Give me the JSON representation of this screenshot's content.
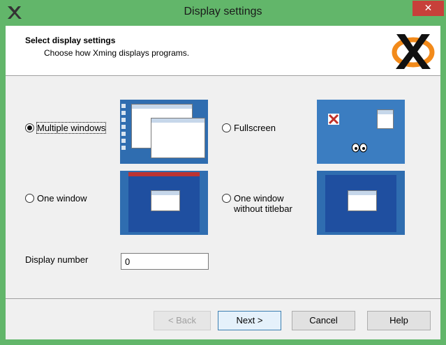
{
  "window": {
    "title": "Display settings",
    "close_label": "✕"
  },
  "header": {
    "title": "Select display settings",
    "subtitle": "Choose how Xming displays programs."
  },
  "options": {
    "multiple": "Multiple windows",
    "fullscreen": "Fullscreen",
    "one_window": "One window",
    "one_window_nt_line1": "One window",
    "one_window_nt_line2": "without titlebar",
    "selected": "Multiple windows"
  },
  "display_number": {
    "label": "Display number",
    "value": "0"
  },
  "buttons": {
    "back": "< Back",
    "next": "Next >",
    "cancel": "Cancel",
    "help": "Help"
  },
  "colors": {
    "titlebar": "#62b66a",
    "close": "#c7403a",
    "desktop": "#2f6db0"
  }
}
